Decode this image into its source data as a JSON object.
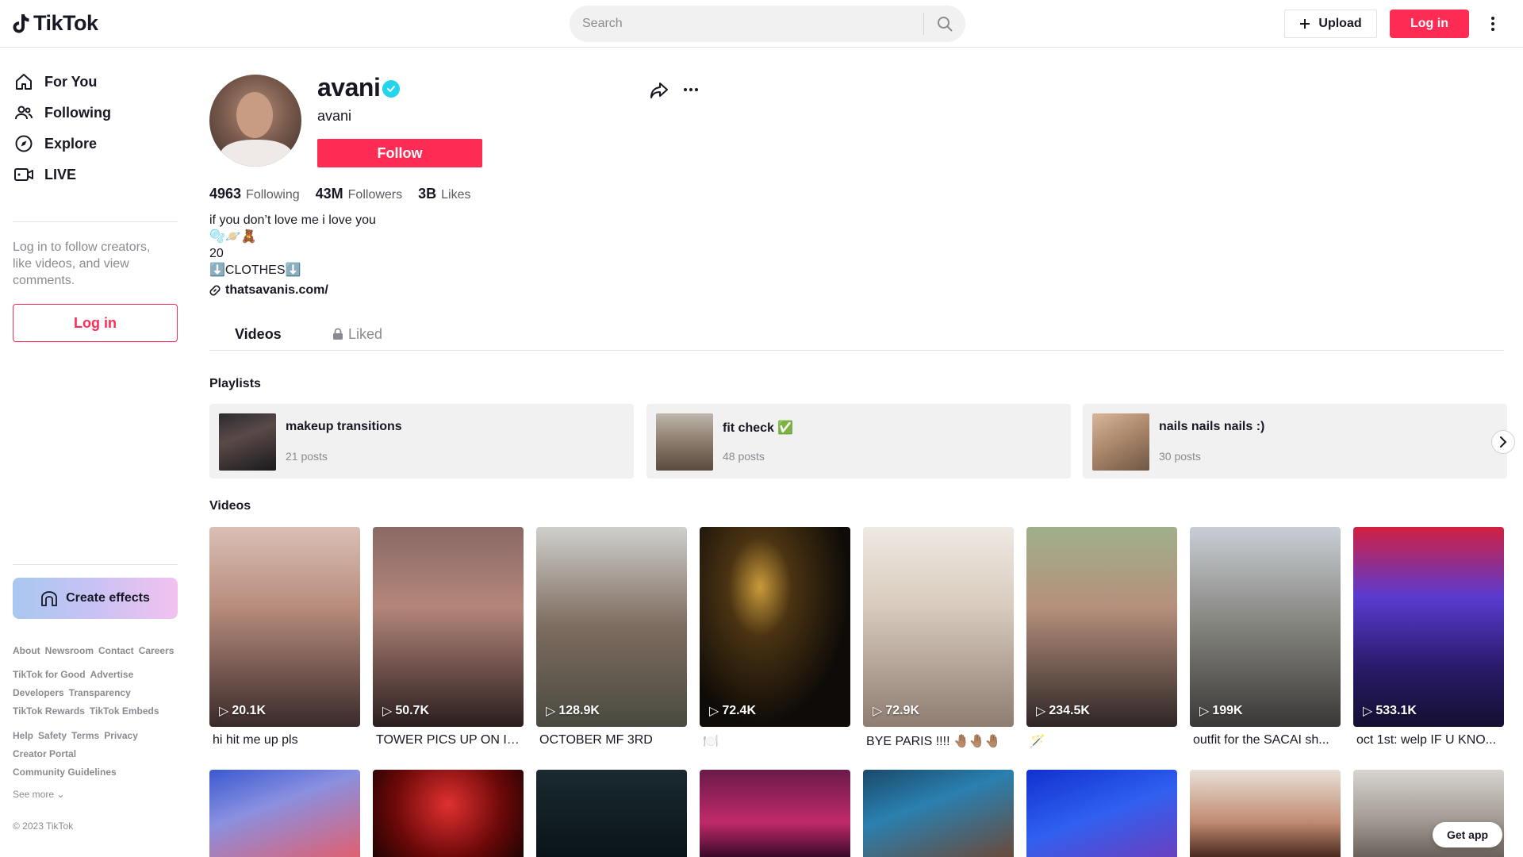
{
  "header": {
    "logo_text": "TikTok",
    "search_placeholder": "Search",
    "upload_label": "Upload",
    "login_label": "Log in"
  },
  "sidebar": {
    "nav": [
      {
        "label": "For You",
        "icon": "home-icon"
      },
      {
        "label": "Following",
        "icon": "users-icon"
      },
      {
        "label": "Explore",
        "icon": "compass-icon"
      },
      {
        "label": "LIVE",
        "icon": "live-icon"
      }
    ],
    "login_prompt": "Log in to follow creators, like videos, and view comments.",
    "login_label": "Log in",
    "create_effects_label": "Create effects",
    "footer_links_1": [
      "About",
      "Newsroom",
      "Contact",
      "Careers"
    ],
    "footer_links_2": [
      "TikTok for Good",
      "Advertise"
    ],
    "footer_links_3": [
      "Developers",
      "Transparency"
    ],
    "footer_links_4": [
      "TikTok Rewards",
      "TikTok Embeds"
    ],
    "footer_links_5": [
      "Help",
      "Safety",
      "Terms",
      "Privacy"
    ],
    "footer_links_6": [
      "Creator Portal"
    ],
    "footer_links_7": [
      "Community Guidelines"
    ],
    "see_more": "See more",
    "copyright": "© 2023 TikTok"
  },
  "profile": {
    "name": "avani",
    "handle": "avani",
    "follow_label": "Follow",
    "stats": {
      "following_count": "4963",
      "following_label": "Following",
      "followers_count": "43M",
      "followers_label": "Followers",
      "likes_count": "3B",
      "likes_label": "Likes"
    },
    "bio": "if you don’t love me i love you\n🫧🪐🧸\n20\n⬇️CLOTHES⬇️",
    "link": "thatsavanis.com/"
  },
  "tabs": {
    "videos": "Videos",
    "liked": "Liked"
  },
  "playlists": {
    "title": "Playlists",
    "items": [
      {
        "title": "makeup transitions",
        "count": "21 posts"
      },
      {
        "title": "fit check ✅",
        "count": "48 posts"
      },
      {
        "title": "nails nails nails :)",
        "count": "30 posts"
      }
    ]
  },
  "videos": {
    "title": "Videos",
    "items": [
      {
        "views": "20.1K",
        "caption": "hi hit me up pls"
      },
      {
        "views": "50.7K",
        "caption": "TOWER PICS UP ON IN..."
      },
      {
        "views": "128.9K",
        "caption": "OCTOBER MF 3RD"
      },
      {
        "views": "72.4K",
        "caption": "🍽️"
      },
      {
        "views": "72.9K",
        "caption": "BYE PARIS !!!! 🤚🏽🤚🏽🤚🏽"
      },
      {
        "views": "234.5K",
        "caption": "🪄"
      },
      {
        "views": "199K",
        "caption": "outfit for the SACAI sh..."
      },
      {
        "views": "533.1K",
        "caption": "oct 1st: welp IF U KNO..."
      }
    ]
  },
  "get_app_label": "Get app",
  "colors": {
    "brand": "#fe2c55",
    "verified": "#20d5ec"
  }
}
